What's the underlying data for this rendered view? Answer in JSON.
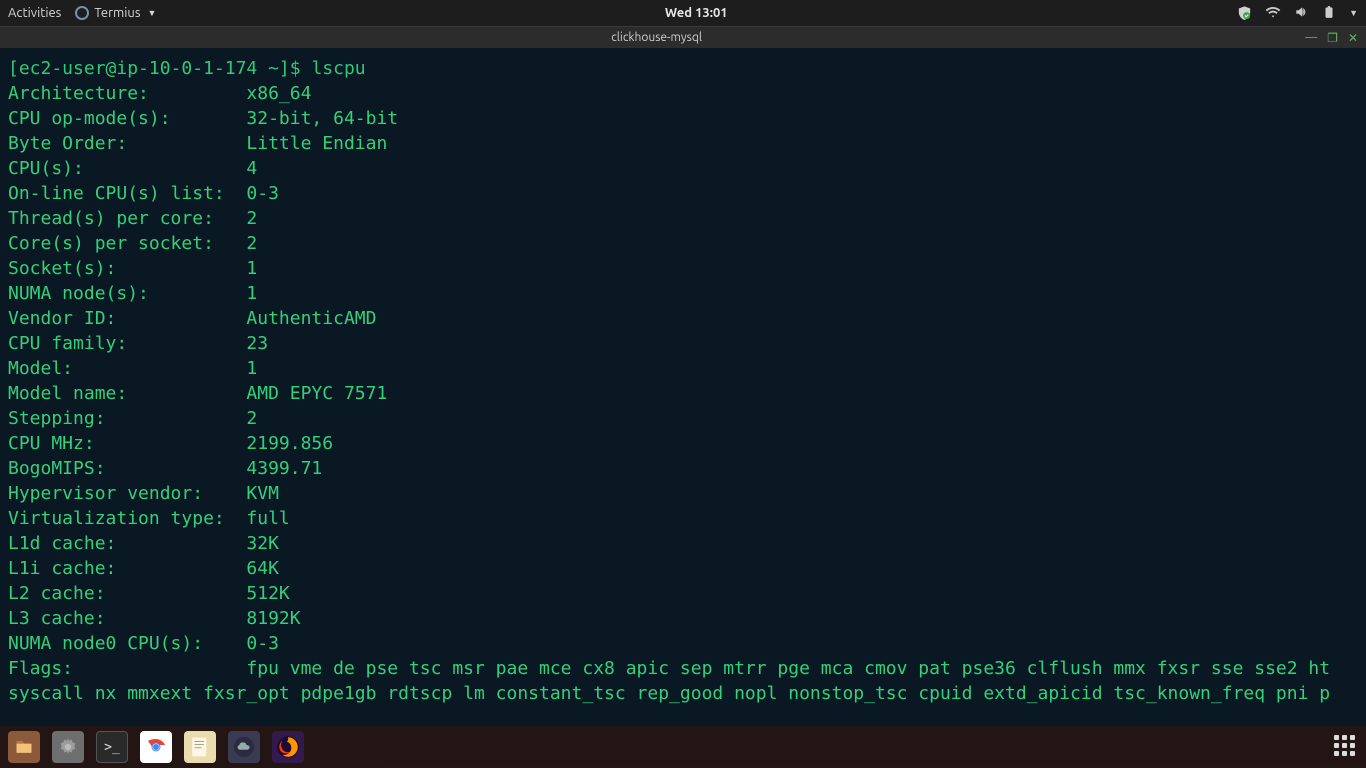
{
  "topbar": {
    "activities": "Activities",
    "app_name": "Termius",
    "clock": "Wed 13:01"
  },
  "window": {
    "title": "clickhouse-mysql"
  },
  "terminal": {
    "prompt": "[ec2-user@ip-10-0-1-174 ~]$",
    "command": "lscpu",
    "rows": [
      {
        "k": "Architecture:",
        "v": "x86_64"
      },
      {
        "k": "CPU op-mode(s):",
        "v": "32-bit, 64-bit"
      },
      {
        "k": "Byte Order:",
        "v": "Little Endian"
      },
      {
        "k": "CPU(s):",
        "v": "4"
      },
      {
        "k": "On-line CPU(s) list:",
        "v": "0-3"
      },
      {
        "k": "Thread(s) per core:",
        "v": "2"
      },
      {
        "k": "Core(s) per socket:",
        "v": "2"
      },
      {
        "k": "Socket(s):",
        "v": "1"
      },
      {
        "k": "NUMA node(s):",
        "v": "1"
      },
      {
        "k": "Vendor ID:",
        "v": "AuthenticAMD"
      },
      {
        "k": "CPU family:",
        "v": "23"
      },
      {
        "k": "Model:",
        "v": "1"
      },
      {
        "k": "Model name:",
        "v": "AMD EPYC 7571"
      },
      {
        "k": "Stepping:",
        "v": "2"
      },
      {
        "k": "CPU MHz:",
        "v": "2199.856"
      },
      {
        "k": "BogoMIPS:",
        "v": "4399.71"
      },
      {
        "k": "Hypervisor vendor:",
        "v": "KVM"
      },
      {
        "k": "Virtualization type:",
        "v": "full"
      },
      {
        "k": "L1d cache:",
        "v": "32K"
      },
      {
        "k": "L1i cache:",
        "v": "64K"
      },
      {
        "k": "L2 cache:",
        "v": "512K"
      },
      {
        "k": "L3 cache:",
        "v": "8192K"
      },
      {
        "k": "NUMA node0 CPU(s):",
        "v": "0-3"
      }
    ],
    "flags_label": "Flags:",
    "flags_first": "fpu vme de pse tsc msr pae mce cx8 apic sep mtrr pge mca cmov pat pse36 clflush mmx fxsr sse sse2 ht",
    "flags_wrap": "syscall nx mmxext fxsr_opt pdpe1gb rdtscp lm constant_tsc rep_good nopl nonstop_tsc cpuid extd_apicid tsc_known_freq pni p"
  }
}
